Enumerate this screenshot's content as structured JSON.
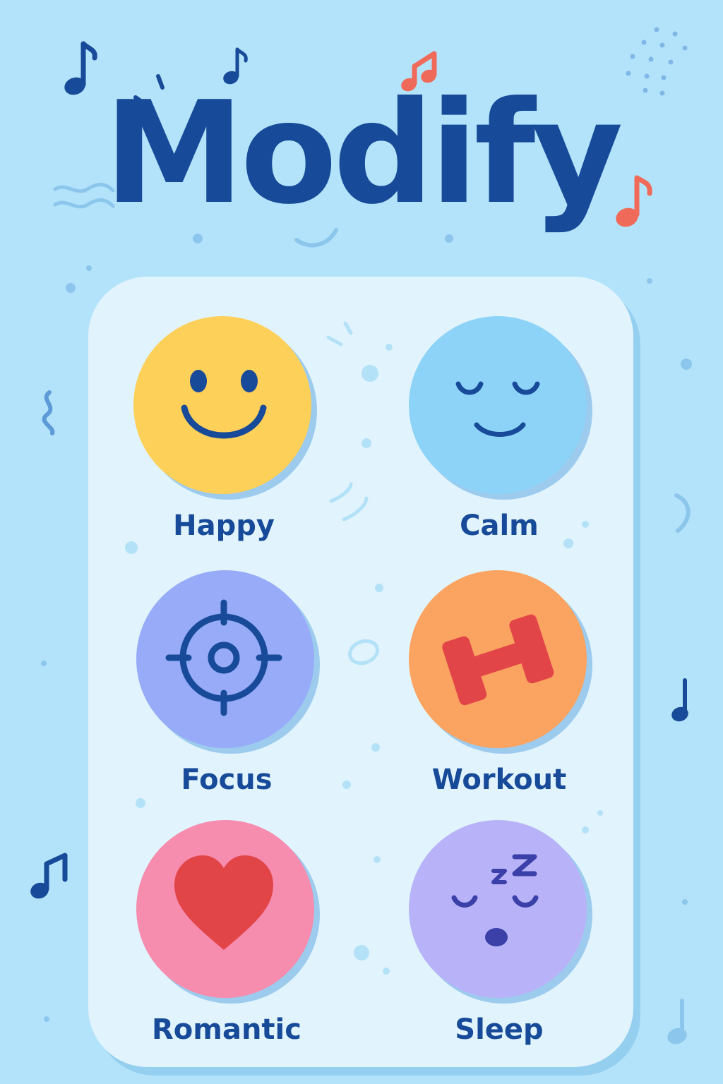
{
  "app": {
    "title": "Modify"
  },
  "colors": {
    "background": "#b3e3fa",
    "panel": "#e1f4fd",
    "brand": "#174a98",
    "note_accent": "#f06a5a"
  },
  "moods": [
    {
      "label": "Happy",
      "icon": "smiley-face-icon",
      "color": "#fdd05a"
    },
    {
      "label": "Calm",
      "icon": "calm-face-icon",
      "color": "#8dd3f8"
    },
    {
      "label": "Focus",
      "icon": "target-crosshair-icon",
      "color": "#97abf8"
    },
    {
      "label": "Workout",
      "icon": "dumbbell-icon",
      "color": "#fba361"
    },
    {
      "label": "Romantic",
      "icon": "heart-icon",
      "color": "#f68cae"
    },
    {
      "label": "Sleep",
      "icon": "sleeping-face-icon",
      "color": "#b8b3f8"
    }
  ]
}
